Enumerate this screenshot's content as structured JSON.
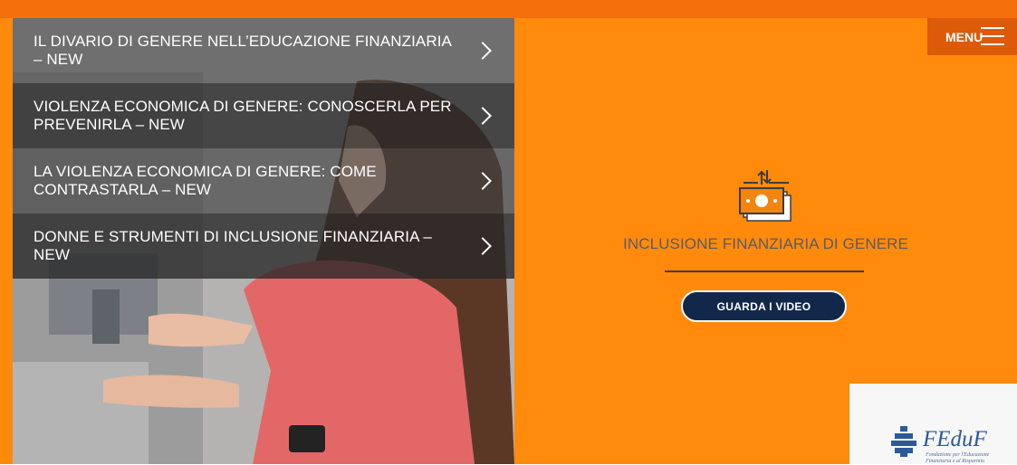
{
  "menu_button": {
    "label": "MENU"
  },
  "video_menu": {
    "items": [
      {
        "label": "IL DIVARIO DI GENERE NELL’EDUCAZIONE FINANZIARIA – NEW"
      },
      {
        "label": "VIOLENZA ECONOMICA DI GENERE: CONOSCERLA PER PREVENIRLA – NEW"
      },
      {
        "label": "LA VIOLENZA ECONOMICA DI GENERE: COME CONTRASTARLA – NEW"
      },
      {
        "label": "DONNE E STRUMENTI DI INCLUSIONE FINANZIARIA – NEW"
      }
    ]
  },
  "feature": {
    "icon": "money-transfer-icon",
    "title": "INCLUSIONE FINANZIARIA DI GENERE",
    "button_label": "GUARDA I VIDEO"
  },
  "logo": {
    "name": "FEduF",
    "subtitle": "Fondazione per l'Educazione Finanziaria e al Risparmio"
  },
  "colors": {
    "background_orange": "#ff8a0c",
    "menu_button": "#dc5a0a",
    "button_navy": "#12284a",
    "title_gray": "#5b5b64"
  }
}
